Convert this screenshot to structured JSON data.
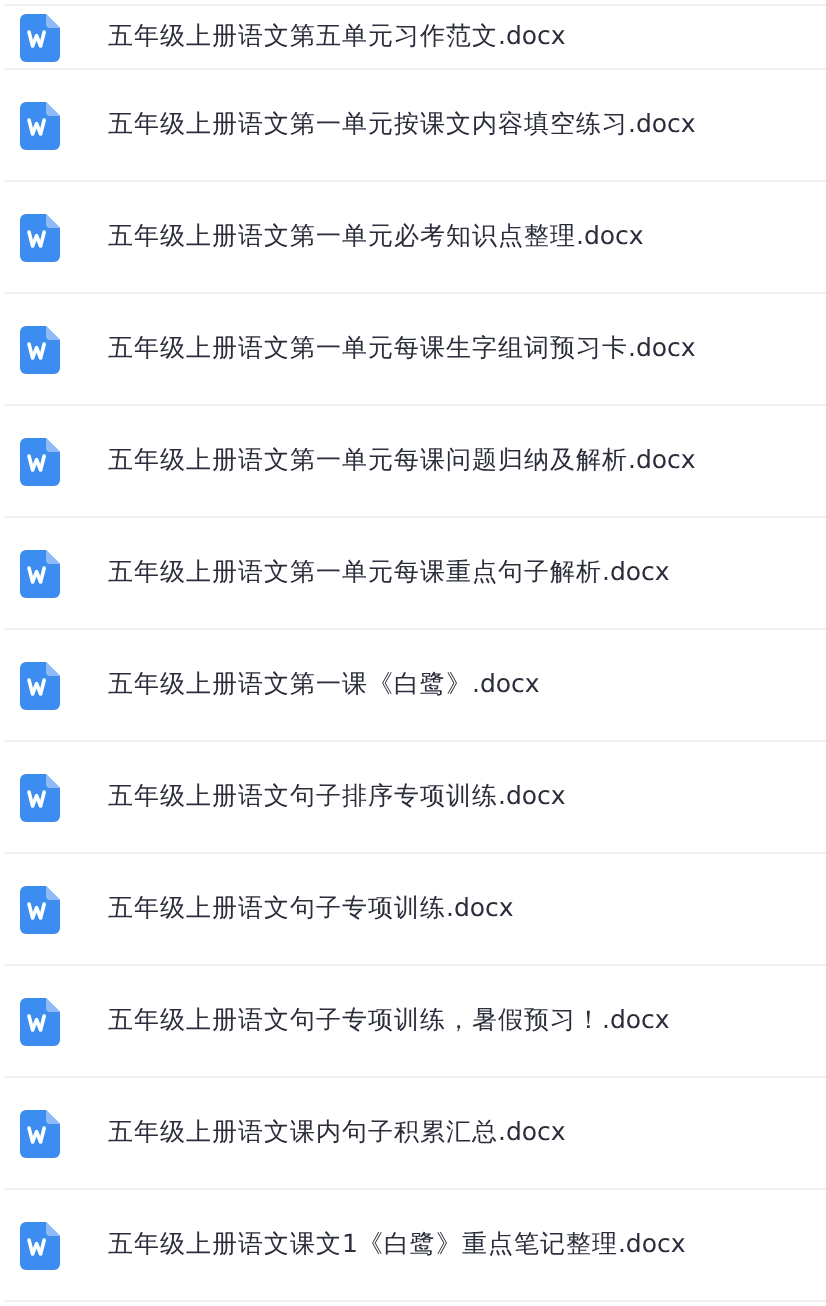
{
  "files": [
    {
      "name": "五年级上册语文第五单元习作范文.docx"
    },
    {
      "name": "五年级上册语文第一单元按课文内容填空练习.docx"
    },
    {
      "name": "五年级上册语文第一单元必考知识点整理.docx"
    },
    {
      "name": "五年级上册语文第一单元每课生字组词预习卡.docx"
    },
    {
      "name": "五年级上册语文第一单元每课问题归纳及解析.docx"
    },
    {
      "name": "五年级上册语文第一单元每课重点句子解析.docx"
    },
    {
      "name": "五年级上册语文第一课《白鹭》.docx"
    },
    {
      "name": "五年级上册语文句子排序专项训练.docx"
    },
    {
      "name": "五年级上册语文句子专项训练.docx"
    },
    {
      "name": "五年级上册语文句子专项训练，暑假预习！.docx"
    },
    {
      "name": "五年级上册语文课内句子积累汇总.docx"
    },
    {
      "name": "五年级上册语文课文1《白鹭》重点笔记整理.docx"
    }
  ]
}
